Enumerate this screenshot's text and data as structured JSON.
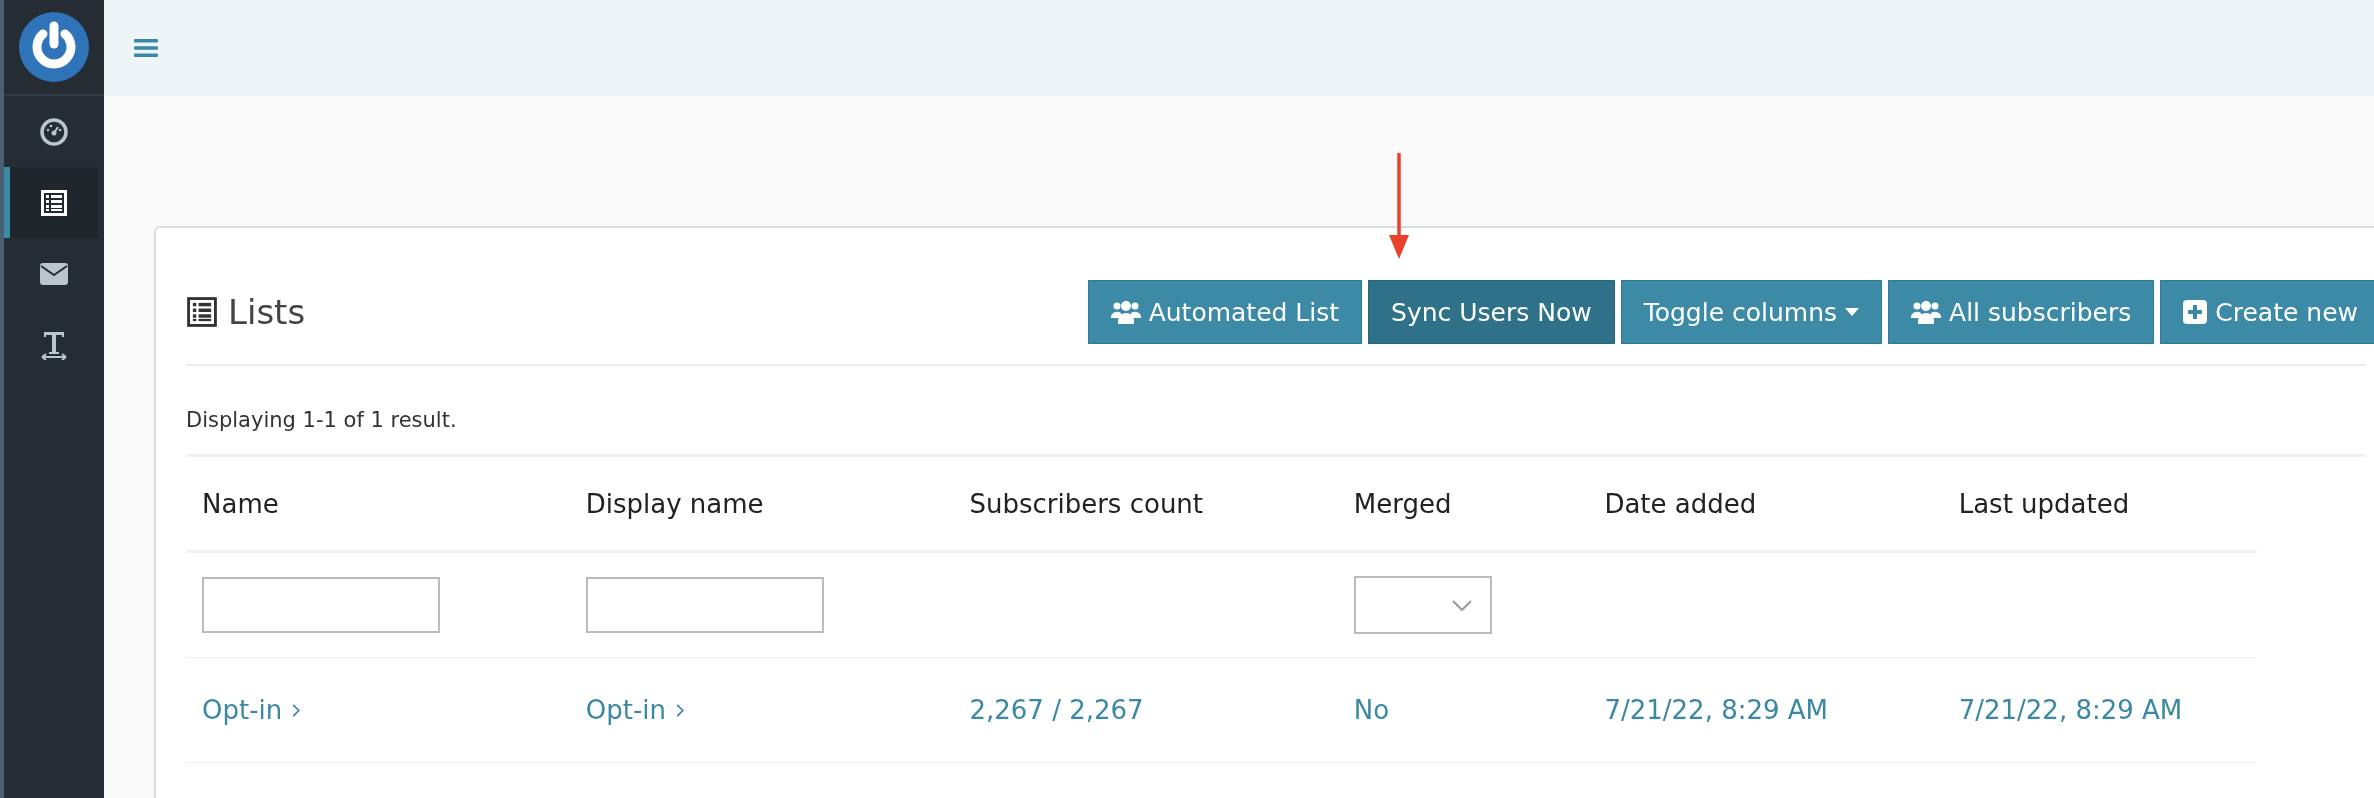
{
  "sidebar": {
    "items": [
      {
        "kind": "gauge",
        "selected": false
      },
      {
        "kind": "list",
        "selected": true
      },
      {
        "kind": "envelope",
        "selected": false
      },
      {
        "kind": "text",
        "selected": false
      }
    ]
  },
  "panel": {
    "title": "Lists",
    "buttons": [
      {
        "label": "Automated List",
        "kind": "users",
        "active": false
      },
      {
        "label": "Sync Users Now",
        "kind": "plain",
        "active": true
      },
      {
        "label": "Toggle columns",
        "kind": "dropdown",
        "active": false
      },
      {
        "label": "All subscribers",
        "kind": "users",
        "active": false
      },
      {
        "label": "Create new",
        "kind": "add",
        "active": false
      }
    ],
    "summary": "Displaying 1-1 of 1 result."
  },
  "table": {
    "columns": [
      {
        "label": "Name",
        "kind": "text"
      },
      {
        "label": "Display name",
        "kind": "text"
      },
      {
        "label": "Subscribers count",
        "kind": "plain"
      },
      {
        "label": "Merged",
        "kind": "select"
      },
      {
        "label": "Date added",
        "kind": "plain"
      },
      {
        "label": "Last updated",
        "kind": "plain"
      }
    ],
    "rows": [
      {
        "cells": [
          {
            "text": "Opt-in",
            "kind": "link"
          },
          {
            "text": "Opt-in",
            "kind": "link"
          },
          {
            "text": "2,267 / 2,267",
            "kind": "value"
          },
          {
            "text": "No",
            "kind": "value"
          },
          {
            "text": "7/21/22, 8:29 AM",
            "kind": "value"
          },
          {
            "text": "7/21/22, 8:29 AM",
            "kind": "value"
          }
        ]
      }
    ]
  },
  "annotation": {
    "kind": "arrow"
  }
}
